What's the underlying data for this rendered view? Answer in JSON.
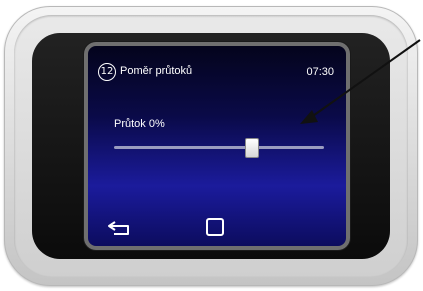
{
  "header": {
    "screen_number": "12",
    "title": "Poměr průtoků",
    "time": "07:30"
  },
  "slider": {
    "label": "Průtok 0%",
    "value_fraction": 0.65
  },
  "footer": {
    "back_icon": "back-arrow-icon",
    "home_icon": "square-home-icon"
  },
  "colors": {
    "screen_top": "#04041c",
    "screen_mid": "#1b1b9c",
    "text": "#ffffff"
  }
}
